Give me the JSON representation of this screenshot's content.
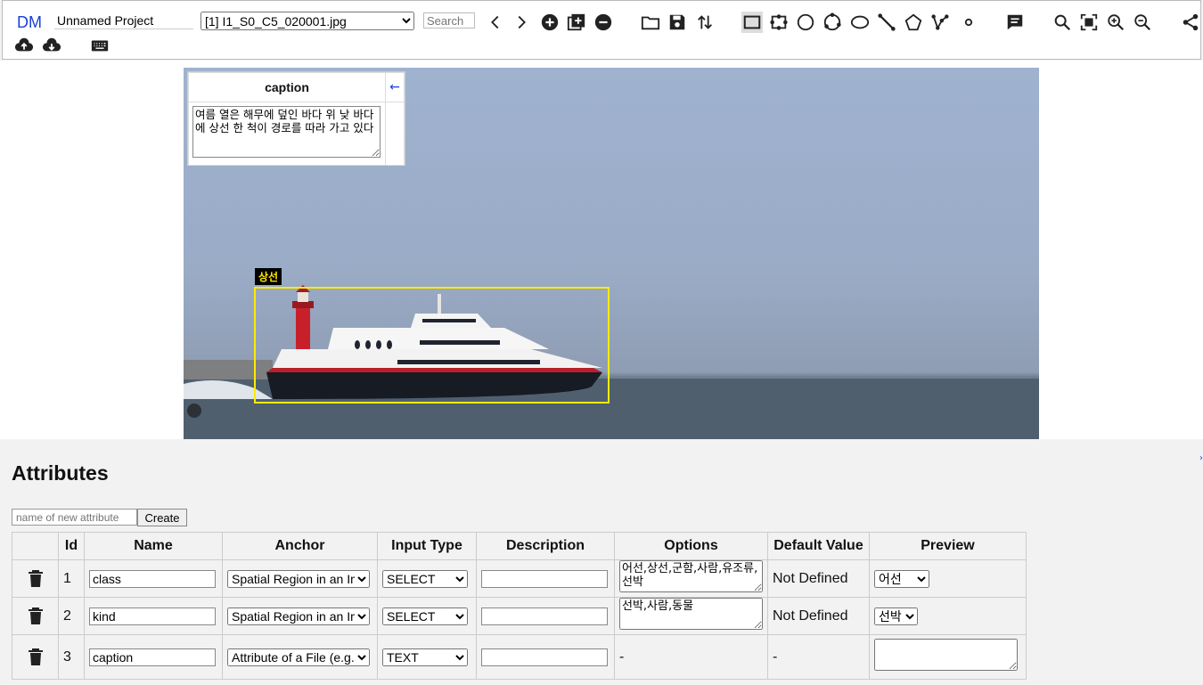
{
  "app": {
    "logo": "DM",
    "project_name": "Unnamed Project"
  },
  "toolbar": {
    "file_selected": "[1] I1_S0_C5_020001.jpg",
    "search_placeholder": "Search"
  },
  "caption_panel": {
    "header": "caption",
    "arrow": "←",
    "text": "여름 열은 해무에 덮인 바다 위 낮 바다에 상선 한 척이 경로를 따라 가고 있다"
  },
  "region": {
    "label": "상선"
  },
  "attributes": {
    "title": "Attributes",
    "new_placeholder": "name of new attribute",
    "create_label": "Create",
    "headers": {
      "id": "Id",
      "name": "Name",
      "anchor": "Anchor",
      "input_type": "Input Type",
      "description": "Description",
      "options": "Options",
      "default": "Default Value",
      "preview": "Preview"
    },
    "rows": [
      {
        "id": "1",
        "name": "class",
        "anchor": "Spatial Region in an Image",
        "input_type": "SELECT",
        "description": "",
        "options": "어선,상선,군함,사람,유조류,선박",
        "default": "Not Defined",
        "preview": "어선"
      },
      {
        "id": "2",
        "name": "kind",
        "anchor": "Spatial Region in an Image",
        "input_type": "SELECT",
        "description": "",
        "options": "선박,사람,동물",
        "default": "Not Defined",
        "preview": "선박"
      },
      {
        "id": "3",
        "name": "caption",
        "anchor": "Attribute of a File (e.g. image caption)",
        "input_type": "TEXT",
        "description": "",
        "options": "-",
        "default": "-",
        "preview": ""
      }
    ]
  },
  "corner_mark": "›"
}
